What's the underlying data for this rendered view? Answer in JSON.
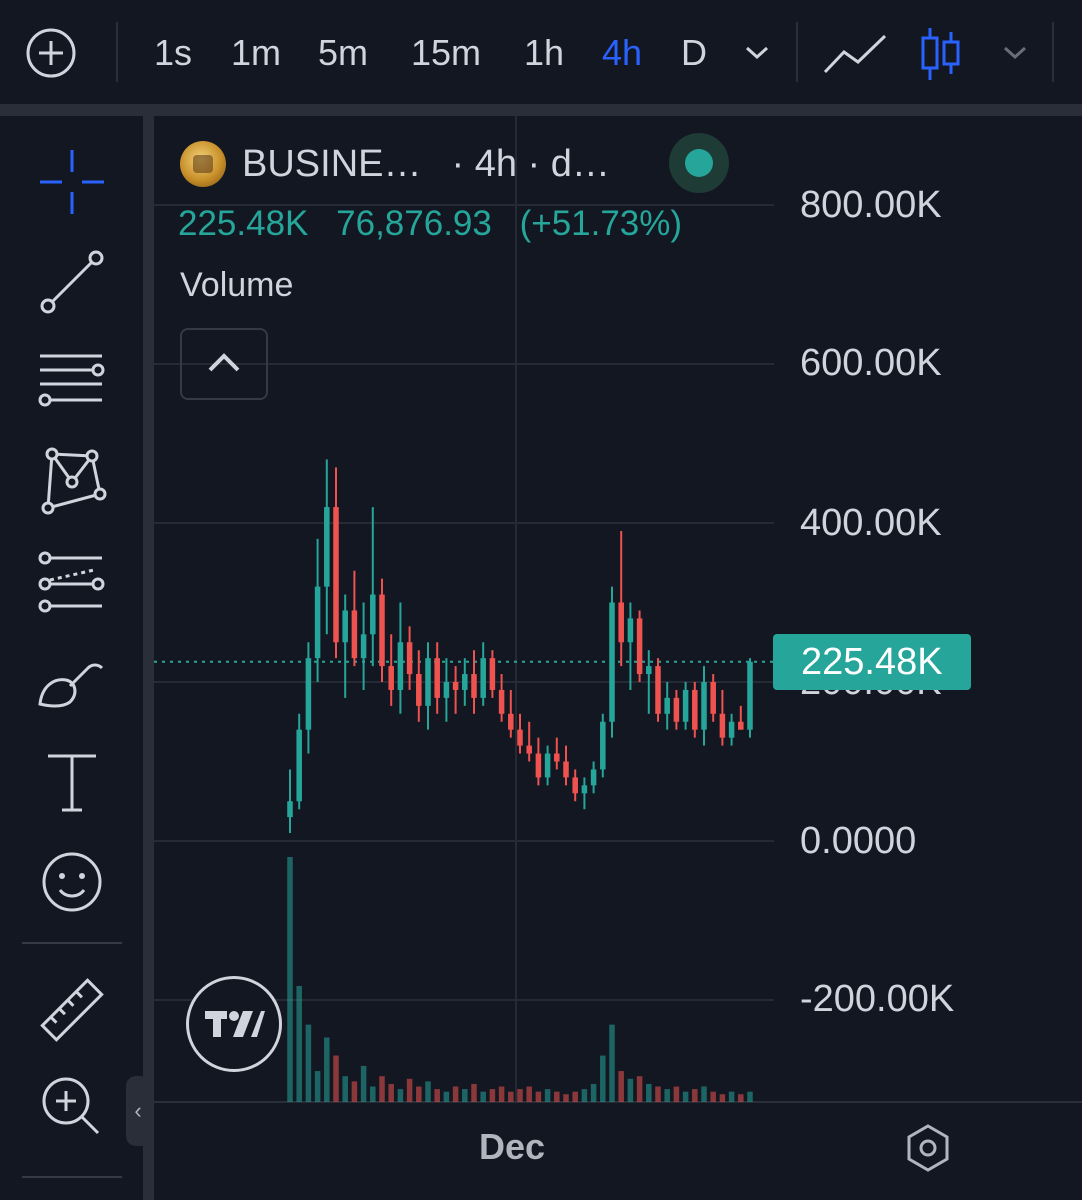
{
  "toolbar": {
    "intervals": [
      "1s",
      "1m",
      "5m",
      "15m",
      "1h",
      "4h",
      "D"
    ],
    "active_interval": "4h"
  },
  "legend": {
    "symbol": "BUSINE…",
    "interval_suffix": "· 4h · d…",
    "last_value": "225.48K",
    "change": "76,876.93",
    "change_pct": "(+51.73%)",
    "indicator": "Volume"
  },
  "price_axis": [
    "800.00K",
    "600.00K",
    "400.00K",
    "0.0000",
    "-200.00K"
  ],
  "price_axis_partial": "200.00K",
  "last_price_tag": "225.48K",
  "time_axis": {
    "label": "Dec"
  },
  "colors": {
    "up": "#26a69a",
    "down": "#ef5350",
    "accent": "#2962ff",
    "background": "#131722"
  },
  "chart_data": {
    "type": "candlestick",
    "title": "BUSINE…",
    "interval": "4h",
    "ylim": [
      -300000,
      900000
    ],
    "candles": [
      [
        30000,
        90000,
        10000,
        50000
      ],
      [
        50000,
        160000,
        40000,
        140000
      ],
      [
        140000,
        250000,
        110000,
        230000
      ],
      [
        230000,
        380000,
        200000,
        320000
      ],
      [
        320000,
        480000,
        260000,
        420000
      ],
      [
        420000,
        470000,
        230000,
        250000
      ],
      [
        250000,
        310000,
        180000,
        290000
      ],
      [
        290000,
        340000,
        220000,
        230000
      ],
      [
        230000,
        300000,
        190000,
        260000
      ],
      [
        260000,
        420000,
        220000,
        310000
      ],
      [
        310000,
        330000,
        200000,
        220000
      ],
      [
        220000,
        260000,
        170000,
        190000
      ],
      [
        190000,
        300000,
        160000,
        250000
      ],
      [
        250000,
        270000,
        190000,
        210000
      ],
      [
        210000,
        240000,
        150000,
        170000
      ],
      [
        170000,
        250000,
        140000,
        230000
      ],
      [
        230000,
        250000,
        160000,
        180000
      ],
      [
        180000,
        230000,
        150000,
        200000
      ],
      [
        200000,
        220000,
        160000,
        190000
      ],
      [
        190000,
        230000,
        170000,
        210000
      ],
      [
        210000,
        240000,
        160000,
        180000
      ],
      [
        180000,
        250000,
        170000,
        230000
      ],
      [
        230000,
        240000,
        180000,
        190000
      ],
      [
        190000,
        210000,
        150000,
        160000
      ],
      [
        160000,
        190000,
        130000,
        140000
      ],
      [
        140000,
        160000,
        110000,
        120000
      ],
      [
        120000,
        150000,
        100000,
        110000
      ],
      [
        110000,
        130000,
        70000,
        80000
      ],
      [
        80000,
        120000,
        70000,
        110000
      ],
      [
        110000,
        130000,
        90000,
        100000
      ],
      [
        100000,
        120000,
        70000,
        80000
      ],
      [
        80000,
        90000,
        50000,
        60000
      ],
      [
        60000,
        80000,
        40000,
        70000
      ],
      [
        70000,
        100000,
        60000,
        90000
      ],
      [
        90000,
        160000,
        80000,
        150000
      ],
      [
        150000,
        320000,
        130000,
        300000
      ],
      [
        300000,
        390000,
        220000,
        250000
      ],
      [
        250000,
        300000,
        190000,
        280000
      ],
      [
        280000,
        290000,
        200000,
        210000
      ],
      [
        210000,
        240000,
        160000,
        220000
      ],
      [
        220000,
        230000,
        150000,
        160000
      ],
      [
        160000,
        200000,
        140000,
        180000
      ],
      [
        180000,
        190000,
        140000,
        150000
      ],
      [
        150000,
        200000,
        140000,
        190000
      ],
      [
        190000,
        200000,
        130000,
        140000
      ],
      [
        140000,
        220000,
        120000,
        200000
      ],
      [
        200000,
        210000,
        150000,
        160000
      ],
      [
        160000,
        190000,
        120000,
        130000
      ],
      [
        130000,
        160000,
        120000,
        150000
      ],
      [
        150000,
        170000,
        140000,
        140000
      ],
      [
        140000,
        230000,
        130000,
        225480
      ]
    ],
    "volume": [
      95,
      45,
      30,
      12,
      25,
      18,
      10,
      8,
      14,
      6,
      10,
      7,
      5,
      9,
      6,
      8,
      5,
      4,
      6,
      5,
      7,
      4,
      5,
      6,
      4,
      5,
      6,
      4,
      5,
      4,
      3,
      4,
      5,
      7,
      18,
      30,
      12,
      9,
      10,
      7,
      6,
      5,
      6,
      4,
      5,
      6,
      4,
      3,
      4,
      3,
      4
    ]
  }
}
